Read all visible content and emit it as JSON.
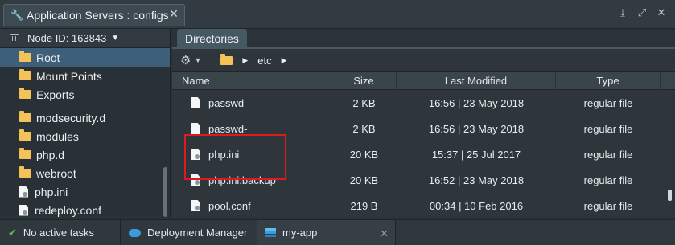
{
  "window": {
    "title": "Application Servers : configs",
    "close": "✕",
    "controls": [
      "download-icon",
      "expand-icon",
      "close-icon"
    ]
  },
  "left": {
    "node_label": "Node ID: 163843",
    "tree": [
      {
        "label": "Root",
        "icon": "folder-icon",
        "selected": true
      },
      {
        "label": "Mount Points",
        "icon": "folder-icon"
      },
      {
        "label": "Exports",
        "icon": "folder-icon"
      },
      {
        "label": "modsecurity.d",
        "icon": "folder-icon"
      },
      {
        "label": "modules",
        "icon": "folder-icon"
      },
      {
        "label": "php.d",
        "icon": "folder-icon"
      },
      {
        "label": "webroot",
        "icon": "folder-icon"
      },
      {
        "label": "php.ini",
        "icon": "config-file-icon"
      },
      {
        "label": "redeploy.conf",
        "icon": "config-file-icon"
      }
    ]
  },
  "right": {
    "tab": "Directories",
    "breadcrumb": [
      "etc"
    ],
    "columns": {
      "name": "Name",
      "size": "Size",
      "modified": "Last Modified",
      "type": "Type"
    },
    "rows": [
      {
        "name": "passwd",
        "size": "2 KB",
        "modified": "16:56 | 23 May 2018",
        "type": "regular file"
      },
      {
        "name": "passwd-",
        "size": "2 KB",
        "modified": "16:56 | 23 May 2018",
        "type": "regular file"
      },
      {
        "name": "php.ini",
        "size": "20 KB",
        "modified": "15:37 | 25 Jul 2017",
        "type": "regular file"
      },
      {
        "name": "php.ini.backup",
        "size": "20 KB",
        "modified": "16:52 | 23 May 2018",
        "type": "regular file"
      },
      {
        "name": "pool.conf",
        "size": "219 B",
        "modified": "00:34 | 10 Feb 2016",
        "type": "regular file"
      }
    ]
  },
  "bottom": {
    "tasks": "No active tasks",
    "deploy": "Deployment Manager",
    "app": "my-app"
  },
  "colors": {
    "highlight": "#e0191f",
    "selected": "#3d5f7a",
    "folder": "#f3c35a"
  }
}
